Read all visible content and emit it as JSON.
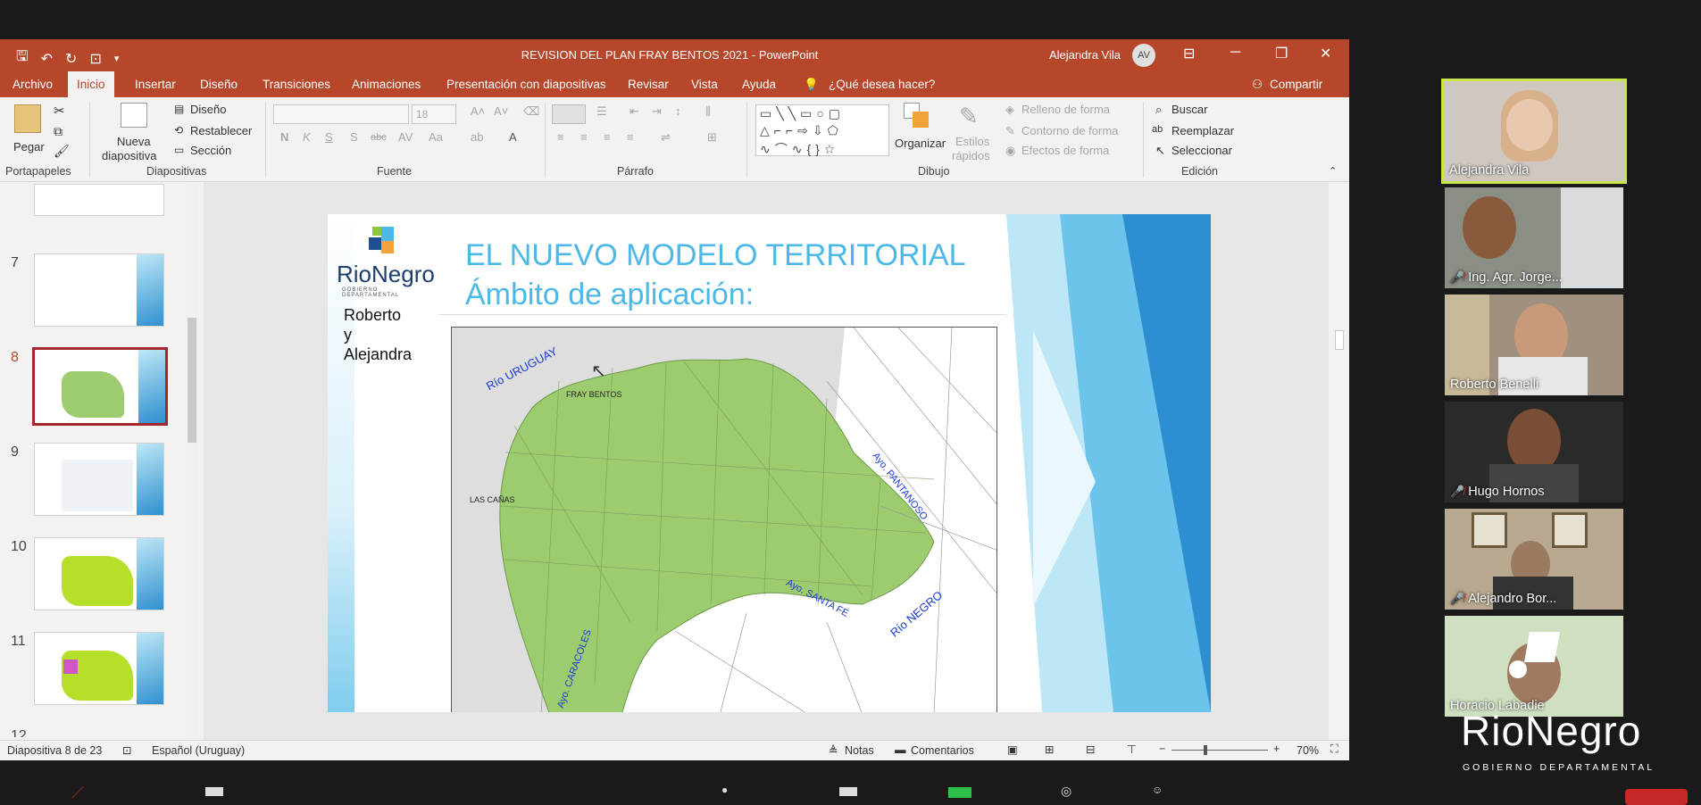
{
  "window": {
    "title": "REVISION DEL PLAN FRAY BENTOS 2021  -  PowerPoint",
    "user_name": "Alejandra Vila",
    "user_initials": "AV"
  },
  "menu": {
    "tabs": [
      "Archivo",
      "Inicio",
      "Insertar",
      "Diseño",
      "Transiciones",
      "Animaciones",
      "Presentación con diapositivas",
      "Revisar",
      "Vista",
      "Ayuda"
    ],
    "tell_me": "¿Qué desea hacer?",
    "share": "Compartir"
  },
  "ribbon": {
    "paste": "Pegar",
    "new_slide_1": "Nueva",
    "new_slide_2": "diapositiva",
    "layout": "Diseño",
    "reset": "Restablecer",
    "section": "Sección",
    "font_size": "18",
    "bold": "N",
    "italic": "K",
    "underline": "S",
    "shadow": "S",
    "strike": "abc",
    "arrange": "Organizar",
    "quick_styles_1": "Estilos",
    "quick_styles_2": "rápidos",
    "shape_fill": "Relleno de forma",
    "shape_outline": "Contorno de forma",
    "shape_effects": "Efectos de forma",
    "find": "Buscar",
    "replace": "Reemplazar",
    "select": "Seleccionar",
    "groups": [
      "Portapapeles",
      "Diapositivas",
      "Fuente",
      "Párrafo",
      "Dibujo",
      "Edición"
    ]
  },
  "thumbnails": {
    "numbers": [
      "7",
      "8",
      "9",
      "10",
      "11",
      "12"
    ],
    "selected": "8"
  },
  "slide": {
    "logo_name": "RioNegro",
    "logo_sub": "GOBIERNO DEPARTAMENTAL",
    "title_line1": "EL NUEVO MODELO TERRITORIAL",
    "title_line2": "Ámbito de aplicación:",
    "side_text": [
      "Roberto",
      "y",
      "Alejandra"
    ],
    "map_labels": {
      "river_uruguay": "Río URUGUAY",
      "fray_bentos": "FRAY BENTOS",
      "las_canas": "LAS CAÑAS",
      "pantanoso": "Ayo. PANTANOSO",
      "santa_fe": "Ayo. SANTA FE",
      "rio_negro": "Río NEGRO",
      "caracoles": "Ayo. CARACOLES"
    }
  },
  "statusbar": {
    "slide_count": "Diapositiva 8 de 23",
    "language": "Español (Uruguay)",
    "notes": "Notas",
    "comments": "Comentarios",
    "zoom": "70%"
  },
  "participants": [
    {
      "name": "Alejandra Vila",
      "muted": false,
      "active": true
    },
    {
      "name": "Ing. Agr. Jorge...",
      "muted": true,
      "active": false
    },
    {
      "name": "Roberto Benelli",
      "muted": false,
      "active": false
    },
    {
      "name": "Hugo Hornos",
      "muted": true,
      "active": false
    },
    {
      "name": "Alejandro Bor...",
      "muted": true,
      "active": false
    },
    {
      "name": "Horacio Labadie",
      "muted": false,
      "active": false
    }
  ],
  "watermark": {
    "name": "RioNegro",
    "sub": "GOBIERNO DEPARTAMENTAL"
  },
  "colors": {
    "ppt_accent": "#b7472a",
    "slide_title": "#4bb8e6",
    "map_green": "#9ccc6e",
    "active_speaker": "#c8e64a",
    "muted_red": "#e03030"
  }
}
